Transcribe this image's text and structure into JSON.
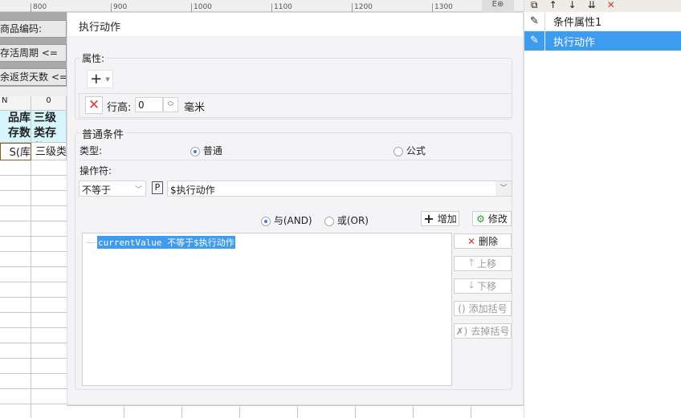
{
  "ruler": {
    "ticks": [
      "800",
      "900",
      "1000",
      "1100",
      "1200",
      "1300"
    ]
  },
  "sheet": {
    "form_labels": [
      "商品编码:",
      "存活周期 <=",
      "余返货天数 <="
    ],
    "col_headers": [
      "N",
      "0"
    ],
    "header_cells": [
      "品库存数量",
      "三级类存数"
    ],
    "data_cells": [
      "S(库",
      "三级类"
    ]
  },
  "dialog": {
    "title": "执行动作",
    "properties": {
      "legend": "属性:",
      "row_height_label": "行高:",
      "row_height_value": "0",
      "unit": "毫米"
    },
    "condition": {
      "legend": "普通条件",
      "type_label": "类型:",
      "type_options": [
        "普通",
        "公式"
      ],
      "type_selected": "普通",
      "operator_label": "操作符:",
      "operator_value": "不等于",
      "param_badge": "P",
      "value": "$执行动作",
      "logic_options": [
        "与(AND)",
        "或(OR)"
      ],
      "logic_selected": "与(AND)",
      "add_label": "增加",
      "modify_label": "修改",
      "list_items": [
        "currentValue 不等于$执行动作"
      ],
      "side_buttons": {
        "delete": "删除",
        "up": "上移",
        "down": "下移",
        "add_bracket": "添加括号",
        "remove_bracket": "去掉括号"
      }
    }
  },
  "right_panel": {
    "items": [
      {
        "label": "条件属性1",
        "selected": false
      },
      {
        "label": "执行动作",
        "selected": true
      }
    ]
  },
  "colors": {
    "accent": "#3d9bf0",
    "delete": "#e53935"
  }
}
